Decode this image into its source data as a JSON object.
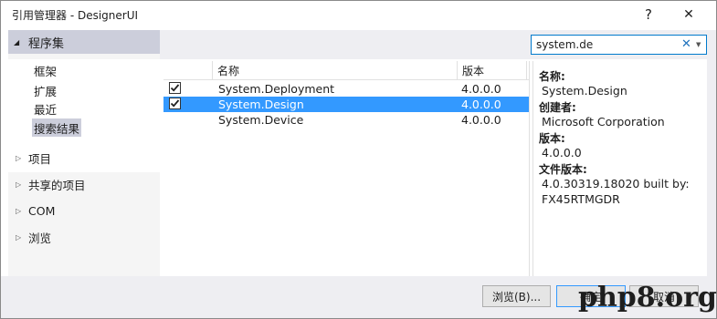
{
  "window": {
    "title": "引用管理器 - DesignerUI",
    "help_glyph": "?",
    "close_glyph": "✕"
  },
  "nav": {
    "assemblies": {
      "label": "程序集",
      "expanded_glyph": "◢",
      "children": [
        "框架",
        "扩展",
        "最近",
        "搜索结果"
      ],
      "selected": "搜索结果"
    },
    "groups": [
      {
        "label": "项目",
        "glyph": "▷"
      },
      {
        "label": "共享的项目",
        "glyph": "▷"
      },
      {
        "label": "COM",
        "glyph": "▷"
      },
      {
        "label": "浏览",
        "glyph": "▷"
      }
    ]
  },
  "search": {
    "value": "system.de",
    "clear_glyph": "✕",
    "dropdown_glyph": "▼"
  },
  "list": {
    "columns": [
      "名称",
      "版本"
    ],
    "rows": [
      {
        "checked": true,
        "name": "System.Deployment",
        "version": "4.0.0.0",
        "selected": false
      },
      {
        "checked": true,
        "name": "System.Design",
        "version": "4.0.0.0",
        "selected": true
      },
      {
        "checked": false,
        "name": "System.Device",
        "version": "4.0.0.0",
        "selected": false
      }
    ]
  },
  "details": {
    "name_label": "名称:",
    "name_value": "System.Design",
    "creator_label": "创建者:",
    "creator_value": "Microsoft Corporation",
    "version_label": "版本:",
    "version_value": "4.0.0.0",
    "file_version_label": "文件版本:",
    "file_version_line1": "4.0.30319.18020 built by:",
    "file_version_line2": "FX45RTMGDR"
  },
  "buttons": {
    "browse": "浏览(B)...",
    "ok": "确定",
    "cancel": "取消"
  },
  "watermark": "php8.org",
  "colors": {
    "selection": "#3399ff",
    "nav_selected": "#cccedb",
    "accent": "#007acc"
  }
}
